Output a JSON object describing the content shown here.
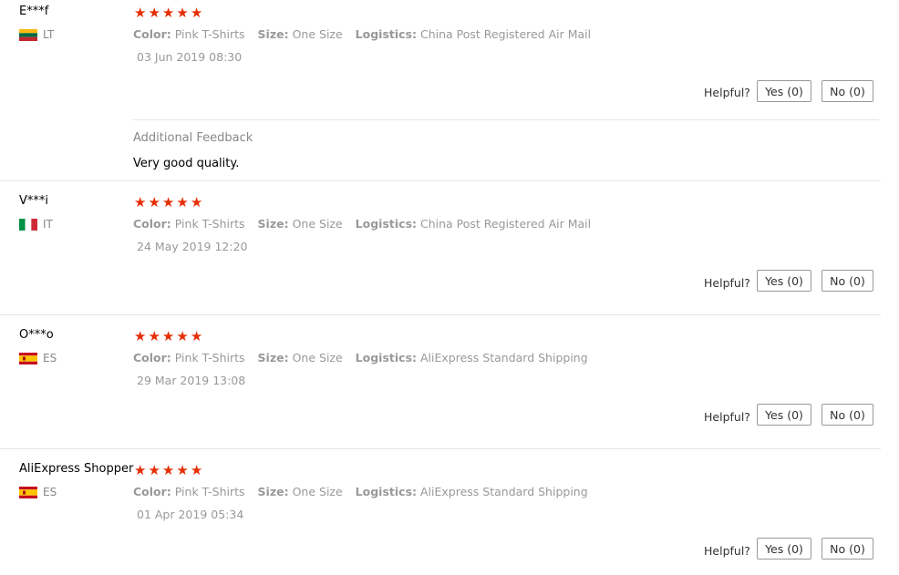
{
  "labels": {
    "color": "Color:",
    "size": "Size:",
    "logistics": "Logistics:",
    "helpful": "Helpful?",
    "additional_feedback": "Additional Feedback",
    "stars": "★★★★★"
  },
  "reviews": [
    {
      "user": "E***f",
      "country": "LT",
      "rating": 5,
      "color": "Pink T-Shirts",
      "size": "One Size",
      "logistics": "China Post Registered Air Mail",
      "date": "03 Jun 2019 08:30",
      "yes": "Yes (0)",
      "no": "No (0)",
      "additional_feedback": "Very good quality."
    },
    {
      "user": "V***i",
      "country": "IT",
      "rating": 5,
      "color": "Pink T-Shirts",
      "size": "One Size",
      "logistics": "China Post Registered Air Mail",
      "date": "24 May 2019 12:20",
      "yes": "Yes (0)",
      "no": "No (0)"
    },
    {
      "user": "O***o",
      "country": "ES",
      "rating": 5,
      "color": "Pink T-Shirts",
      "size": "One Size",
      "logistics": "AliExpress Standard Shipping",
      "date": "29 Mar 2019 13:08",
      "yes": "Yes (0)",
      "no": "No (0)"
    },
    {
      "user": "AliExpress Shopper",
      "country": "ES",
      "rating": 5,
      "color": "Pink T-Shirts",
      "size": "One Size",
      "logistics": "AliExpress Standard Shipping",
      "date": "01 Apr 2019 05:34",
      "yes": "Yes (0)",
      "no": "No (0)"
    }
  ],
  "colors": {
    "star": "#e62e04",
    "flag_lt": [
      "#fdb913",
      "#006a44",
      "#c1272d"
    ],
    "flag_it": [
      "#009246",
      "#ffffff",
      "#ce2b37"
    ],
    "flag_es": [
      "#c60b1e",
      "#ffc400",
      "#c60b1e"
    ]
  }
}
